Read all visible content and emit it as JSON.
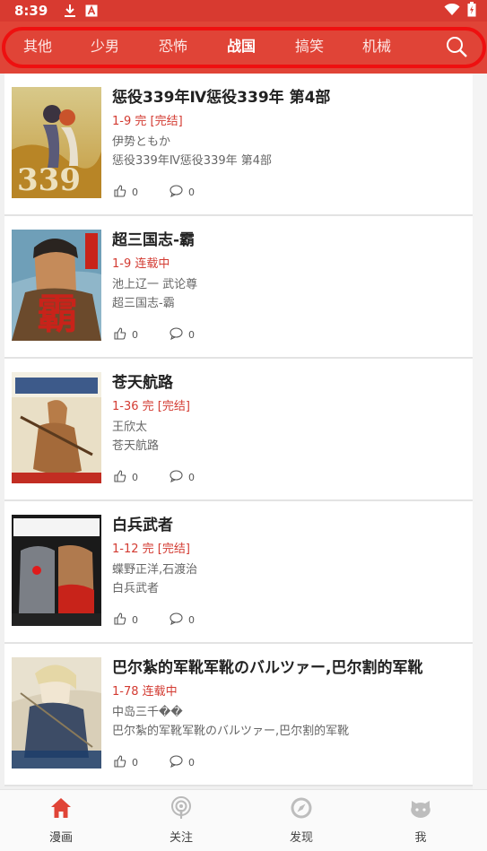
{
  "status_bar": {
    "time": "8:39",
    "icons": [
      "download-icon",
      "notification-a-icon",
      "wifi-icon",
      "battery-charging-icon"
    ]
  },
  "tabs": [
    {
      "label": "其他",
      "active": false
    },
    {
      "label": "少男",
      "active": false
    },
    {
      "label": "恐怖",
      "active": false
    },
    {
      "label": "战国",
      "active": true
    },
    {
      "label": "搞笑",
      "active": false
    },
    {
      "label": "机械",
      "active": false
    }
  ],
  "comics": [
    {
      "title": "惩役339年Ⅳ惩役339年 第4部",
      "status": "1-9 完 [完结]",
      "author": "伊势ともか",
      "subtitle": "惩役339年Ⅳ惩役339年 第4部",
      "likes": "0",
      "comments": "0"
    },
    {
      "title": "超三国志-霸",
      "status": "1-9 连载中",
      "author": "池上辽一 武论尊",
      "subtitle": "超三国志-霸",
      "likes": "0",
      "comments": "0"
    },
    {
      "title": "苍天航路",
      "status": "1-36 完 [完结]",
      "author": "王欣太",
      "subtitle": "苍天航路",
      "likes": "0",
      "comments": "0"
    },
    {
      "title": "白兵武者",
      "status": "1-12 完 [完结]",
      "author": "蝶野正洋,石渡治",
      "subtitle": "白兵武者",
      "likes": "0",
      "comments": "0"
    },
    {
      "title": "巴尔紮的军靴军靴のバルツァー,巴尔割的军靴",
      "status": "1-78 连载中",
      "author": "中岛三千��",
      "subtitle": "巴尔紮的军靴军靴のバルツァー,巴尔割的军靴",
      "likes": "0",
      "comments": "0"
    }
  ],
  "bottom_nav": [
    {
      "label": "漫画",
      "icon": "home-icon",
      "active": true
    },
    {
      "label": "关注",
      "icon": "podcast-icon",
      "active": false
    },
    {
      "label": "发现",
      "icon": "compass-icon",
      "active": false
    },
    {
      "label": "我",
      "icon": "github-cat-icon",
      "active": false
    }
  ],
  "colors": {
    "brand": "#e04437",
    "status_red": "#d33b32",
    "annotation_ring": "#ee1010"
  }
}
